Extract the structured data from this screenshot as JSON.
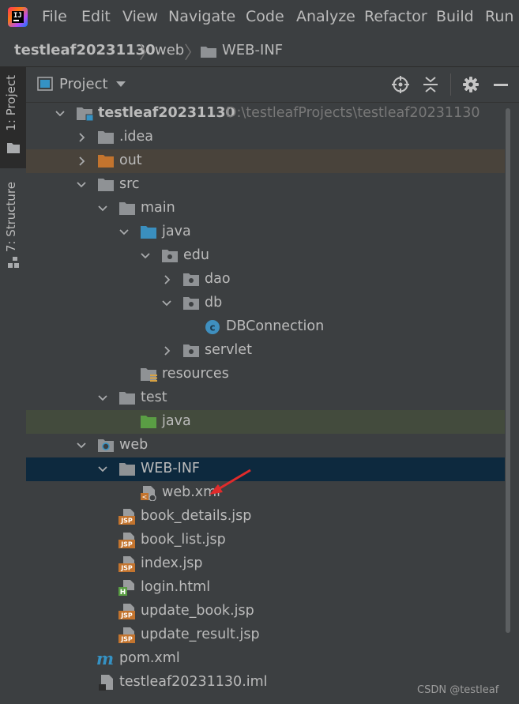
{
  "menubar": {
    "items": [
      "File",
      "Edit",
      "View",
      "Navigate",
      "Code",
      "Analyze",
      "Refactor",
      "Build",
      "Run"
    ]
  },
  "navbar": {
    "crumbs": [
      "testleaf20231130",
      "web",
      "WEB-INF"
    ]
  },
  "toolwindow_tabs": {
    "project": "1: Project",
    "structure": "7: Structure"
  },
  "panel": {
    "title": "Project"
  },
  "tree": [
    {
      "label": "testleaf20231130",
      "path": "D:\\testleafProjects\\testleaf20231130",
      "icon": "module-folder-icon",
      "expanded": true,
      "bold": true
    },
    {
      "label": ".idea",
      "icon": "folder-icon",
      "expanded": false
    },
    {
      "label": "out",
      "icon": "excluded-folder-icon",
      "expanded": false
    },
    {
      "label": "src",
      "icon": "folder-icon",
      "expanded": true
    },
    {
      "label": "main",
      "icon": "folder-icon",
      "expanded": true
    },
    {
      "label": "java",
      "icon": "source-root-folder-icon",
      "expanded": true
    },
    {
      "label": "edu",
      "icon": "package-icon",
      "expanded": true
    },
    {
      "label": "dao",
      "icon": "package-icon",
      "expanded": false
    },
    {
      "label": "db",
      "icon": "package-icon",
      "expanded": true
    },
    {
      "label": "DBConnection",
      "icon": "java-class-icon"
    },
    {
      "label": "servlet",
      "icon": "package-icon",
      "expanded": false
    },
    {
      "label": "resources",
      "icon": "resources-folder-icon"
    },
    {
      "label": "test",
      "icon": "folder-icon",
      "expanded": true
    },
    {
      "label": "java",
      "icon": "test-root-folder-icon"
    },
    {
      "label": "web",
      "icon": "web-folder-icon",
      "expanded": true
    },
    {
      "label": "WEB-INF",
      "icon": "folder-icon",
      "expanded": true,
      "selected": true
    },
    {
      "label": "web.xml",
      "icon": "web-xml-file-icon"
    },
    {
      "label": "book_details.jsp",
      "icon": "jsp-file-icon"
    },
    {
      "label": "book_list.jsp",
      "icon": "jsp-file-icon"
    },
    {
      "label": "index.jsp",
      "icon": "jsp-file-icon"
    },
    {
      "label": "login.html",
      "icon": "html-file-icon"
    },
    {
      "label": "update_book.jsp",
      "icon": "jsp-file-icon"
    },
    {
      "label": "update_result.jsp",
      "icon": "jsp-file-icon"
    },
    {
      "label": "pom.xml",
      "icon": "maven-file-icon"
    },
    {
      "label": "testleaf20231130.iml",
      "icon": "iml-file-icon"
    }
  ],
  "watermark": "CSDN @testleaf",
  "colors": {
    "background": "#3c3f41",
    "selection": "#0d293e",
    "excluded_row": "#49433b",
    "test_row": "#434b3d",
    "folder": "#8f9295",
    "source_root": "#3a8fbf",
    "excluded": "#c3742e",
    "test_root": "#5a9e44",
    "annotation_arrow": "#e02b2b"
  }
}
